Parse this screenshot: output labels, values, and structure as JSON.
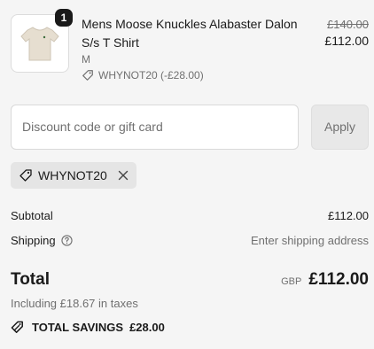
{
  "product": {
    "quantity": "1",
    "name": "Mens Moose Knuckles Alabaster Dalon S/s T Shirt",
    "variant": "M",
    "discount_text": "WHYNOT20 (-£28.00)",
    "original_price": "£140.00",
    "price": "£112.00"
  },
  "discount": {
    "placeholder": "Discount code or gift card",
    "apply_label": "Apply",
    "applied_code": "WHYNOT20"
  },
  "summary": {
    "subtotal_label": "Subtotal",
    "subtotal_value": "£112.00",
    "shipping_label": "Shipping",
    "shipping_value": "Enter shipping address",
    "total_label": "Total",
    "currency": "GBP",
    "total_value": "£112.00",
    "taxes_text": "Including £18.67 in taxes",
    "savings_label": "TOTAL SAVINGS",
    "savings_value": "£28.00"
  },
  "colors": {
    "background": "#f5f5f5",
    "text": "#1a1a1a",
    "muted": "#707070",
    "tshirt": "#e6ded0"
  }
}
